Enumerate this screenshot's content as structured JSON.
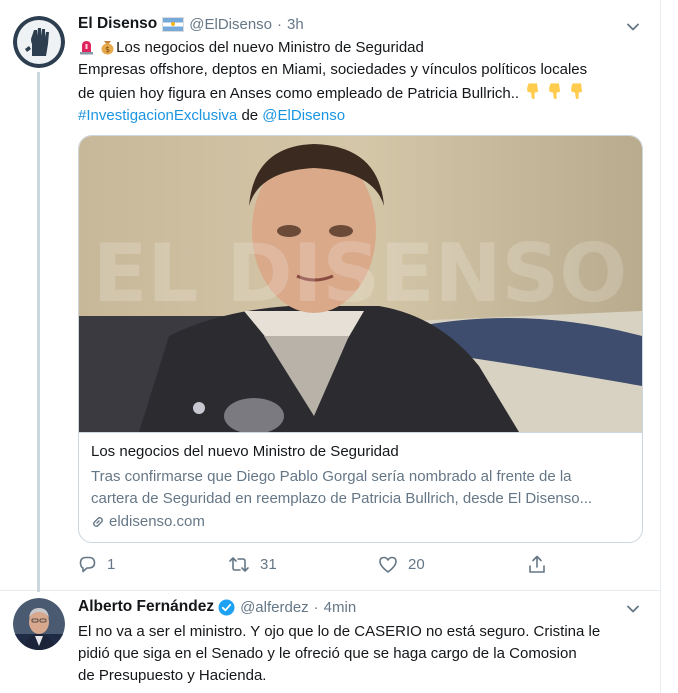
{
  "tweets": [
    {
      "author": {
        "name": "El Disenso",
        "handle": "@ElDisenso",
        "time": "3h",
        "flag": "argentina-flag"
      },
      "text": {
        "line1": "Los negocios del nuevo Ministro de Seguridad",
        "line2": "Empresas offshore, deptos en Miami, sociedades y vínculos políticos locales",
        "line3": "de quien hoy figura en Anses como empleado de Patricia Bullrich..",
        "hashtag": "#InvestigacionExclusiva",
        "connector": "de",
        "mention": "@ElDisenso"
      },
      "card": {
        "watermark": "EL DISENSO",
        "title": "Los negocios del nuevo Ministro de Seguridad",
        "desc_line1": "Tras confirmarse que Diego Pablo Gorgal sería nombrado al frente de la",
        "desc_line2": "cartera de Seguridad en reemplazo de Patricia Bullrich, desde El Disenso...",
        "domain": "eldisenso.com"
      },
      "actions": {
        "reply_count": "1",
        "retweet_count": "31",
        "like_count": "20"
      }
    },
    {
      "author": {
        "name": "Alberto Fernández",
        "handle": "@alferdez",
        "time": "4min",
        "verified": true
      },
      "text": {
        "line1": "El no va a ser el ministro. Y ojo que lo de CASERIO no está seguro. Cristina le",
        "line2": "pidió que siga en el Senado y le ofreció que se haga cargo de la Comosion",
        "line3": "de Presupuesto y Hacienda."
      }
    }
  ],
  "separator": "·",
  "colors": {
    "link": "#1b95e0",
    "muted": "#657786",
    "text": "#14171a",
    "border": "#ccd6dd",
    "verified": "#1da1f2"
  },
  "icons": [
    "caret-down-icon",
    "siren-emoji-icon",
    "money-bag-emoji-icon",
    "thumbs-down-emoji-icon",
    "link-icon",
    "reply-icon",
    "retweet-icon",
    "like-icon",
    "share-icon",
    "verified-badge-icon"
  ]
}
